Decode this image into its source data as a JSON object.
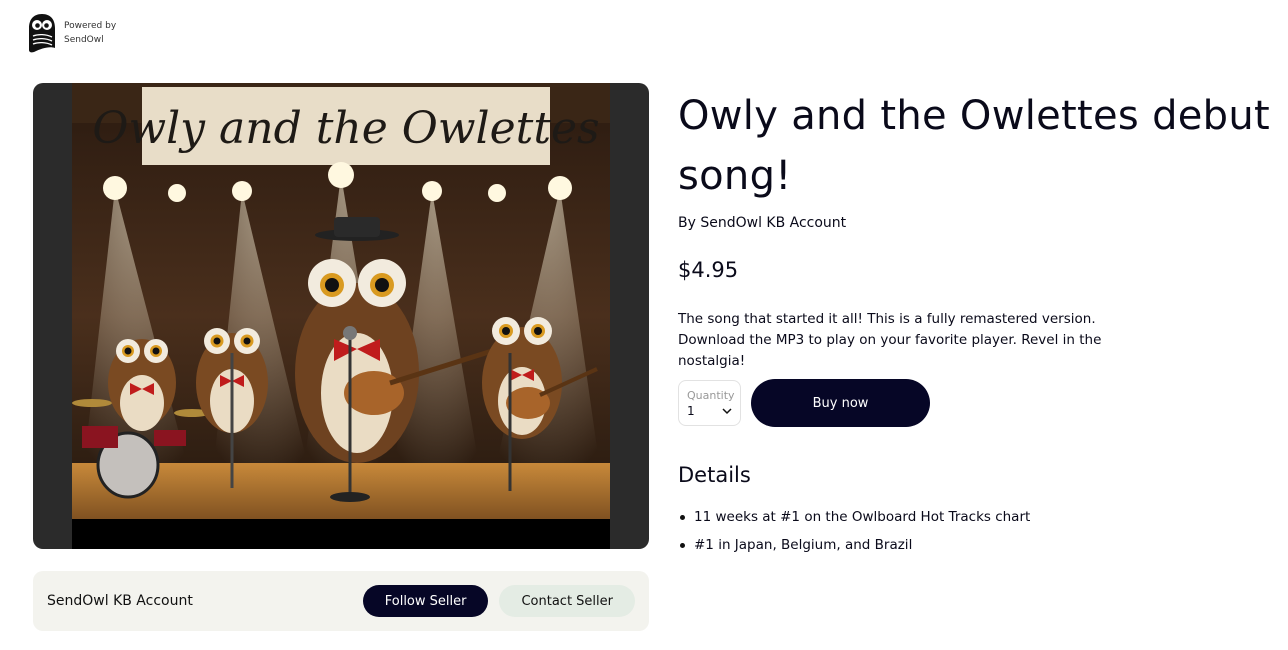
{
  "brand": {
    "line1": "Powered by",
    "line2": "SendOwl",
    "logo_icon": "owl-logo-icon"
  },
  "product": {
    "title": "Owly and the Owlettes debut song!",
    "author": "By SendOwl KB Account",
    "price": "$4.95",
    "description": "The song that started it all! This is a fully remastered version. Download the MP3 to play on your favorite player. Revel in the nostalgia!",
    "image_banner_text": "Owly and the Owlettes"
  },
  "purchase": {
    "quantity_label": "Quantity",
    "quantity_value": "1",
    "buy_label": "Buy now"
  },
  "details": {
    "heading": "Details",
    "items": [
      "11 weeks at #1 on the Owlboard Hot Tracks chart",
      "#1 in Japan, Belgium, and Brazil"
    ]
  },
  "seller": {
    "name": "SendOwl KB Account",
    "follow_label": "Follow Seller",
    "contact_label": "Contact Seller"
  },
  "colors": {
    "primary_button": "#060626",
    "secondary_button": "#e4ece4",
    "seller_bar_bg": "#f3f3ee",
    "media_bg": "#2b2b2b"
  }
}
